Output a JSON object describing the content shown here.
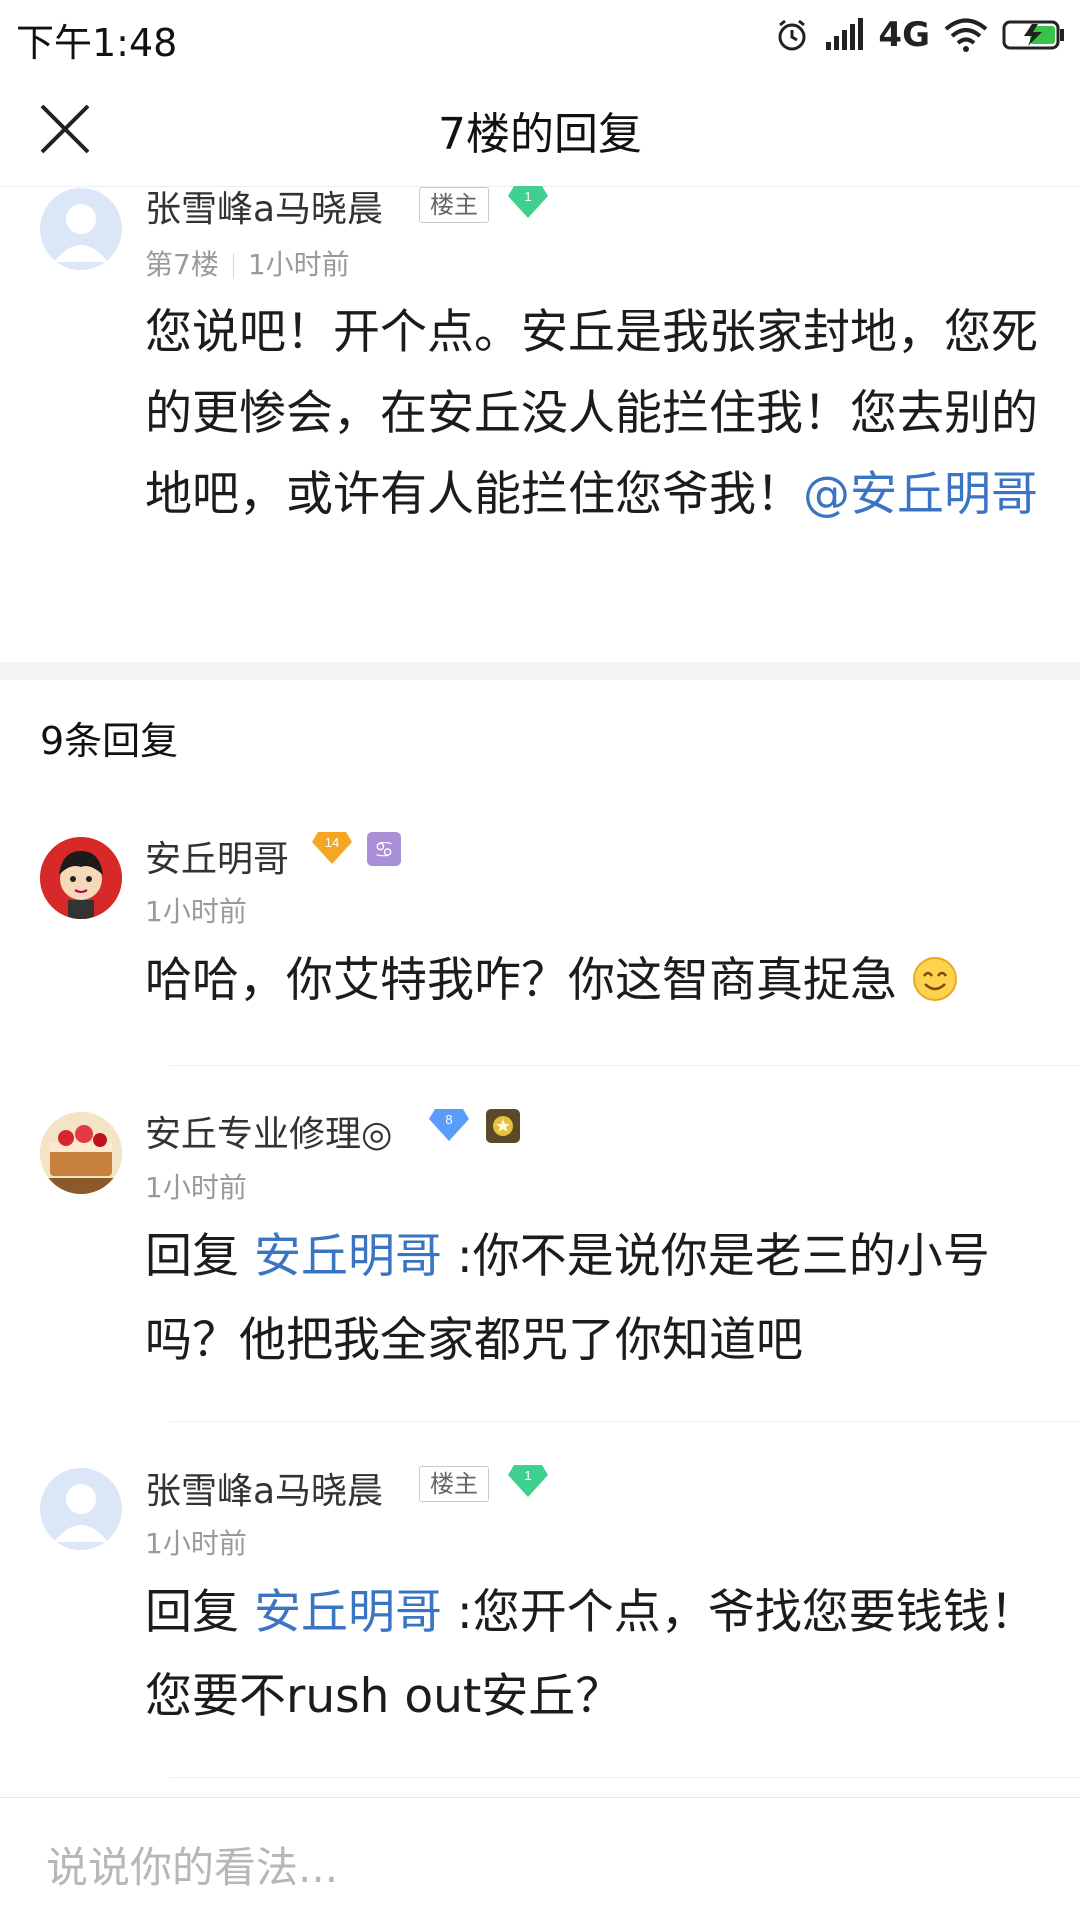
{
  "status": {
    "time": "下午1:48",
    "network": "4G"
  },
  "nav": {
    "title": "7楼的回复"
  },
  "main_post": {
    "username": "张雪峰a马晓晨",
    "owner_tag": "楼主",
    "level": "1",
    "floor": "第7楼",
    "time": "1小时前",
    "content": "您说吧！开个点。安丘是我张家封地，您死的更惨会，在安丘没人能拦住我！您去别的地吧，或许有人能拦住您爷我！",
    "mention": "@安丘明哥"
  },
  "replies_count": "9条回复",
  "replies": [
    {
      "username": "安丘明哥",
      "level": "14",
      "time": "1小时前",
      "content": "哈哈，你艾特我咋？你这智商真捉急"
    },
    {
      "username": "安丘专业修理◎",
      "level": "8",
      "time": "1小时前",
      "reply_prefix": "回复",
      "reply_to": "安丘明哥",
      "content": " :你不是说你是老三的小号吗？他把我全家都咒了你知道吧"
    },
    {
      "username": "张雪峰a马晓晨",
      "owner_tag": "楼主",
      "level": "1",
      "time": "1小时前",
      "reply_prefix": "回复",
      "reply_to": "安丘明哥",
      "content": " :您开个点，爷找您要钱钱！您要不rush out安丘？"
    }
  ],
  "input": {
    "placeholder": "说说你的看法..."
  },
  "colors": {
    "mention": "#3b74c2",
    "level_green": "#3fcf8e",
    "level_orange": "#f5a623",
    "level_blue": "#5a9cf8"
  }
}
